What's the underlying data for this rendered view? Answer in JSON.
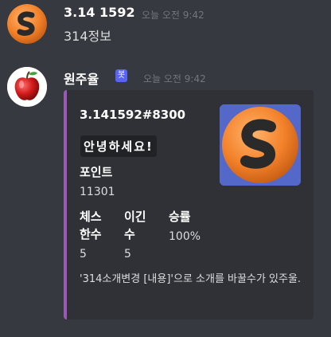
{
  "messages": [
    {
      "author": "3.14   1592",
      "timestamp": "오늘 오전 9:42",
      "content": "314정보"
    },
    {
      "author": "원주율",
      "bot_tag": "봇",
      "timestamp": "오늘 오전 9:42"
    }
  ],
  "embed": {
    "accent_color": "#9b59b6",
    "title": "3.141592#8300",
    "greeting": "안녕하세요!",
    "fields": [
      {
        "name": "포인트",
        "value": "11301"
      },
      {
        "name": "체스\n한수",
        "value": "5"
      },
      {
        "name": "이긴\n수",
        "value": "5"
      },
      {
        "name": "승률",
        "value": "100%"
      }
    ],
    "footer_text": "'314소개변경 [내용]'으로 소개를 바꿀수가 있주울.",
    "thumbnail_icon": "s-logo-icon"
  },
  "avatars": {
    "user": "s-logo-icon",
    "bot": "apple-icon"
  }
}
